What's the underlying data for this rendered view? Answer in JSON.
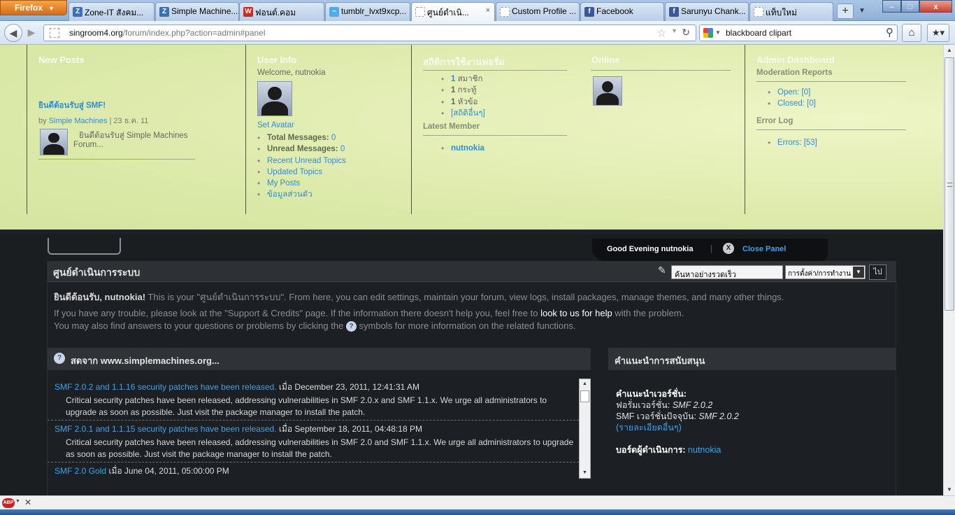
{
  "browser": {
    "firefox_label": "Firefox",
    "firefox_caret": "▼",
    "tabs": [
      {
        "label": "Zone-IT สังคม...",
        "icon": "Z",
        "color": "#3b6fb6"
      },
      {
        "label": "Simple Machine...",
        "icon": "Z",
        "color": "#3b6fb6"
      },
      {
        "label": "ฟอนต์.คอม",
        "icon": "W",
        "color": "#d9261c"
      },
      {
        "label": "tumblr_lvxt9xcp...",
        "icon": "~",
        "color": "#54a9e8"
      },
      {
        "label": "ศูนย์ดำเนิ...",
        "icon": "",
        "color": "#ffffff"
      },
      {
        "label": "Custom Profile ...",
        "icon": "",
        "color": "#ffffff"
      },
      {
        "label": "Facebook",
        "icon": "f",
        "color": "#3b5998"
      },
      {
        "label": "Sarunyu Chank...",
        "icon": "f",
        "color": "#3b5998"
      },
      {
        "label": "แท็บใหม่",
        "icon": "",
        "color": "#ffffff"
      }
    ],
    "new_tab": "+",
    "tab_list": "▼",
    "win_min": "–",
    "win_max": "□",
    "win_close": "x",
    "tab_close": "×",
    "back": "◀",
    "forward": "▶",
    "url_host": "singroom4.org",
    "url_path": "/forum/index.php?action=admin#panel",
    "bookmark_star": "☆",
    "url_dropdown": "▼",
    "reload": "↻",
    "search_text": "blackboard clipart",
    "search_engine_caret": "▼",
    "search_icon": "⚲",
    "home_icon": "⌂",
    "bookmarks_icon": "★▾",
    "scroll_up": "▲",
    "scroll_down": "▼"
  },
  "panel": {
    "new_posts": {
      "title": "New Posts",
      "post_title": "ยินดีต้อนรับสู่ SMF!",
      "by": "by",
      "author": "Simple Machines",
      "date": "| 23 ธ.ค. 11",
      "excerpt_line1": "ยินดีต้อนรับสู่ Simple Machines",
      "excerpt_line2": "Forum..."
    },
    "user_info": {
      "title": "User Info",
      "welcome": "Welcome, nutnokia",
      "set_avatar": "Set Avatar",
      "total_messages_label": "Total Messages:",
      "total_messages_value": "0",
      "unread_messages_label": "Unread Messages:",
      "unread_messages_value": "0",
      "links": [
        "Recent Unread Topics",
        "Updated Topics",
        "My Posts",
        "ข้อมูลส่วนตัว"
      ]
    },
    "stats": {
      "title": "สถิติการใช้งานฟอรั่ม",
      "items": [
        {
          "num": "1",
          "label": "สมาชิก"
        },
        {
          "num": "1",
          "label": "กระทู้"
        },
        {
          "num": "1",
          "label": "หัวข้อ"
        }
      ],
      "more_link": "[สถิติอื่นๆ]",
      "latest_member_title": "Latest Member",
      "latest_member": "nutnokia"
    },
    "online": {
      "title": "Online"
    },
    "admin_dashboard": {
      "title": "Admin Dashboard",
      "moderation_title": "Moderation Reports",
      "open": "Open: [0]",
      "closed": "Closed: [0]",
      "error_log_title": "Error Log",
      "errors": "Errors: [53]"
    }
  },
  "greeting": {
    "text": "Good Evening  nutnokia",
    "separator": "|",
    "close_x": "X",
    "close_label": "Close Panel"
  },
  "admin": {
    "title": "ศูนย์ดำเนินการระบบ",
    "quick_search_icon": "✎",
    "quick_search_placeholder": "ค้นหาอย่างรวดเร็ว",
    "quick_search_select": "การตั้งค่า/การทำงาน",
    "quick_search_arrow": "▼",
    "go": "ไป",
    "welcome_prefix": "ยินดีต้อนรับ, nutnokia!",
    "welcome_rest": " This is your \"ศูนย์ดำเนินการระบบ\". From here, you can edit settings, maintain your forum, view logs, install packages, manage themes, and many other things.",
    "trouble_text": "If you have any trouble, please look at the \"Support & Credits\" page. If the information there doesn't help you, feel free to ",
    "trouble_link": "look to us for help",
    "trouble_end": " with the problem.",
    "help_text_start": "You may also find answers to your questions or problems by clicking the ",
    "help_icon": "?",
    "help_text_end": " symbols for more information on the related functions."
  },
  "news": {
    "title": "สดจาก www.simplemachines.org...",
    "icon": "?",
    "items": [
      {
        "title": "SMF 2.0.2 and 1.1.16 security patches have been released.",
        "date": " เมื่อ December 23, 2011, 12:41:31 AM",
        "body": "Critical security patches have been released, addressing vulnerabilities in SMF 2.0.x and SMF 1.1.x. We urge all administrators to upgrade as soon as possible. Just visit the package manager to install the patch."
      },
      {
        "title": "SMF 2.0.1 and 1.1.15 security patches have been released.",
        "date": " เมื่อ September 18, 2011, 04:48:18 PM",
        "body": "Critical security patches have been released, addressing vulnerabilities in SMF 2.0 and SMF 1.1.x. We urge all administrators to upgrade as soon as possible. Just visit the package manager to install the patch."
      },
      {
        "title": "SMF 2.0 Gold",
        "date": " เมื่อ June 04, 2011, 05:00:00 PM",
        "body": ""
      }
    ],
    "scroll_up": "▲",
    "scroll_down": "▼"
  },
  "support": {
    "title": "คำแนะนำการสนับสนุน",
    "version_heading": "คำแนะนำเวอร์ชั่น:",
    "forum_version_label": "ฟอรั่มเวอร์ชั่น:",
    "forum_version_value": "SMF 2.0.2",
    "current_version_label": "SMF เวอร์ชั่นปัจจุบัน:",
    "current_version_value": "SMF 2.0.2",
    "details_link": "(รายละเอียดอื่นๆ)",
    "admins_label": "บอร์ดผู้ดำเนินการ:",
    "admins_value": "nutnokia"
  },
  "statusbar": {
    "abp_label": "ABP",
    "abp_caret": "▼",
    "close": "✕"
  }
}
